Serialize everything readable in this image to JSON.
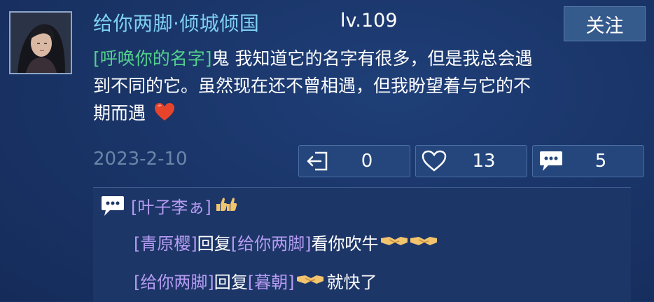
{
  "post": {
    "author": "给你两脚·倾城倾国",
    "level": "lv.109",
    "follow_label": "关注",
    "mention_tag": "[呼唤你的名字]",
    "text_line1": "鬼 我知道它的名字有很多，但是我总会遇",
    "text_line2": "到不同的它。虽然现在还不曾相遇，但我盼望着与它的不",
    "text_line3": "期而遇",
    "date": "2023-2-10"
  },
  "stats": {
    "share_count": "0",
    "like_count": "13",
    "comment_count": "5"
  },
  "comments": [
    {
      "user": "[叶子李ぁ]",
      "reply_word": "",
      "target": "",
      "text": ""
    },
    {
      "user": "[青原樱]",
      "reply_word": "回复",
      "target": "[给你两脚]",
      "text": "看你吹牛"
    },
    {
      "user": "[给你两脚]",
      "reply_word": "回复",
      "target": "[暮朝]",
      "text": "就快了"
    }
  ],
  "colors": {
    "username": "#7ed0f2",
    "mention": "#53d18c",
    "comment_user": "#b59cf2",
    "date": "#6b85a8",
    "background": "#1a3569"
  },
  "icons": {
    "share": "share-exit-icon",
    "like": "heart-outline-icon",
    "comment": "speech-bubble-icon"
  }
}
